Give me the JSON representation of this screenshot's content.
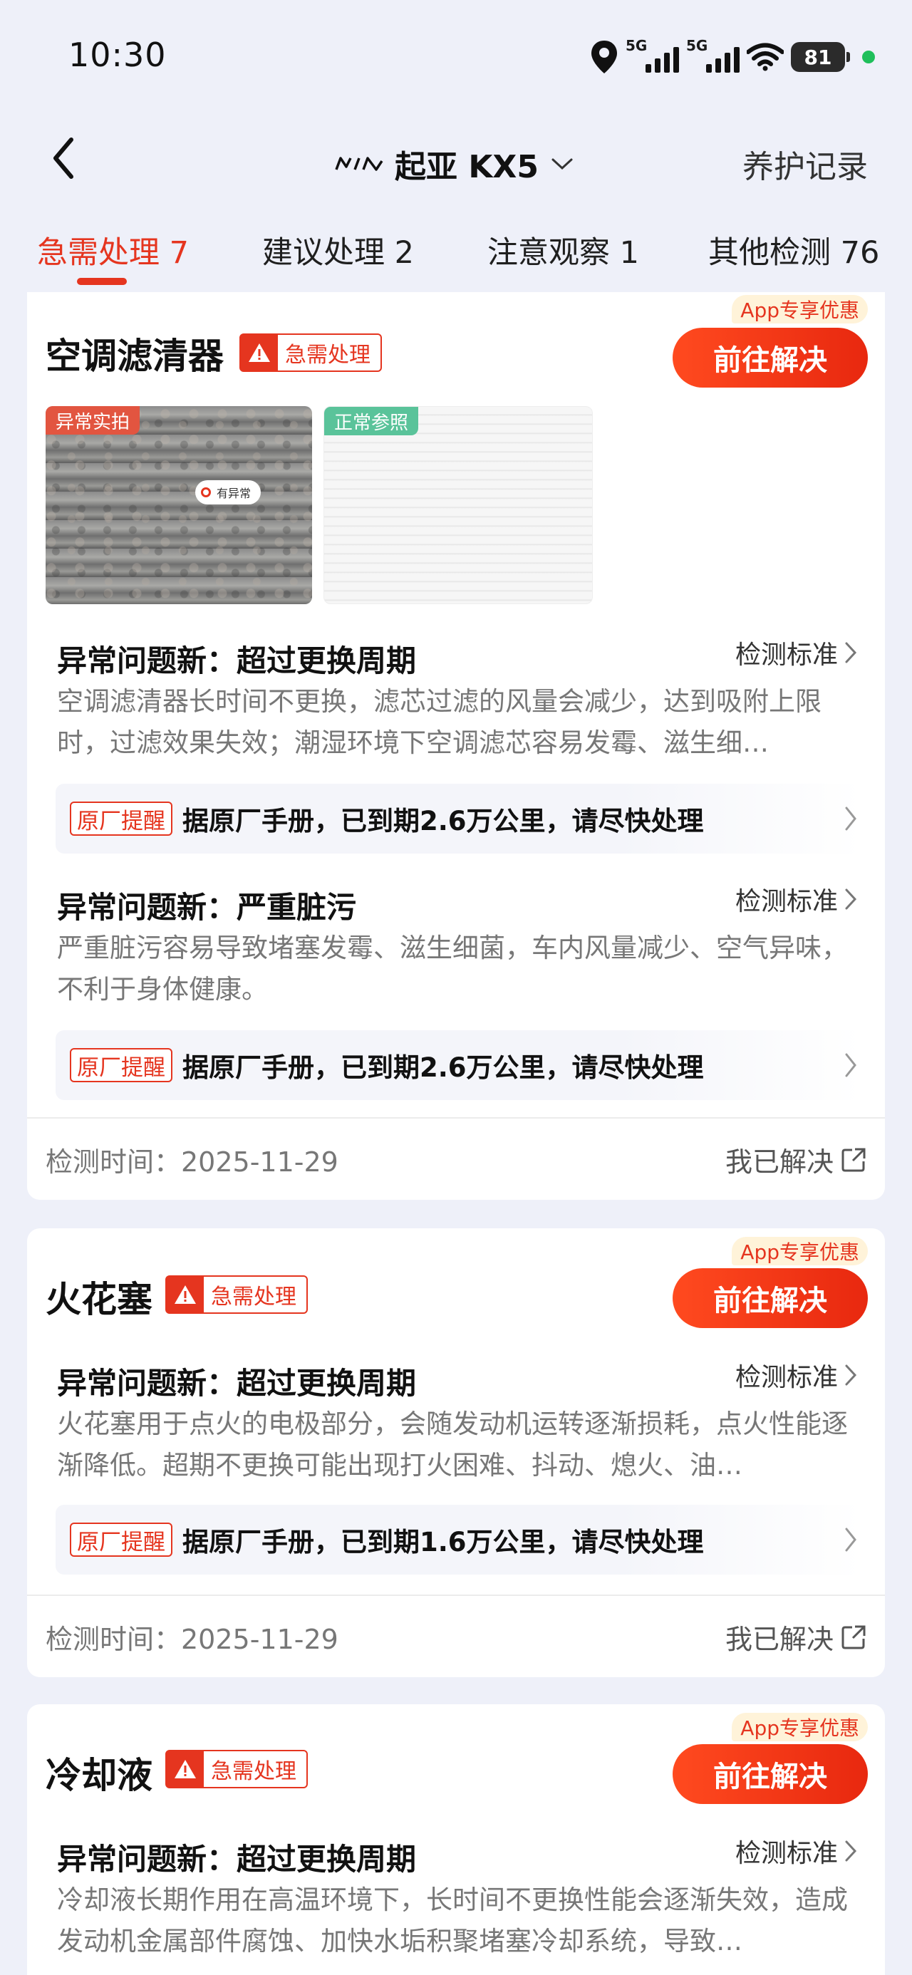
{
  "status": {
    "time": "10:30",
    "net1": "5G",
    "net2": "5G",
    "battery": "81"
  },
  "header": {
    "title": "起亚 KX5",
    "right_link": "养护记录"
  },
  "tabs": [
    {
      "label": "急需处理 7"
    },
    {
      "label": "建议处理 2"
    },
    {
      "label": "注意观察 1"
    },
    {
      "label": "其他检测 76"
    }
  ],
  "common": {
    "urgent_tag": "急需处理",
    "promo": "App专享优惠",
    "go_button": "前往解决",
    "standard_link": "检测标准",
    "remind_tag": "原厂提醒",
    "solved": "我已解决"
  },
  "cards": [
    {
      "title": "空调滤清器",
      "photos": {
        "abnormal_label": "异常实拍",
        "normal_label": "正常参照",
        "pin_text": "有异常"
      },
      "issues": [
        {
          "title": "异常问题新：超过更换周期",
          "desc": "空调滤清器长时间不更换，滤芯过滤的风量会减少，达到吸附上限时，过滤效果失效；潮湿环境下空调滤芯容易发霉、滋生细…",
          "remind": "据原厂手册，已到期2.6万公里，请尽快处理"
        },
        {
          "title": "异常问题新：严重脏污",
          "desc": "严重脏污容易导致堵塞发霉、滋生细菌，车内风量减少、空气异味，不利于身体健康。",
          "remind": "据原厂手册，已到期2.6万公里，请尽快处理"
        }
      ],
      "detect_time": "检测时间：2025-11-29"
    },
    {
      "title": "火花塞",
      "issues": [
        {
          "title": "异常问题新：超过更换周期",
          "desc": "火花塞用于点火的电极部分，会随发动机运转逐渐损耗，点火性能逐渐降低。超期不更换可能出现打火困难、抖动、熄火、油…",
          "remind": "据原厂手册，已到期1.6万公里，请尽快处理"
        }
      ],
      "detect_time": "检测时间：2025-11-29"
    },
    {
      "title": "冷却液",
      "issues": [
        {
          "title": "异常问题新：超过更换周期",
          "desc": "冷却液长期作用在高温环境下，长时间不更换性能会逐渐失效，造成发动机金属部件腐蚀、加快水垢积聚堵塞冷却系统，导致…"
        }
      ]
    }
  ],
  "colors": {
    "accent": "#e5351f",
    "background": "#eef0f9",
    "promo_bg": "#fff3d9",
    "normal_green": "#5ac39a"
  }
}
